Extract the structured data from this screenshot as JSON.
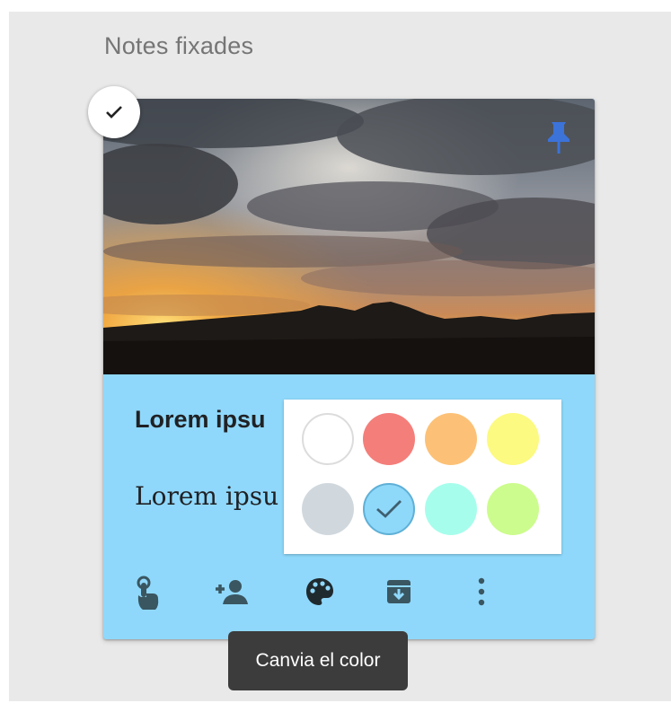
{
  "section": {
    "title": "Notes fixades"
  },
  "note": {
    "title": "Lorem ipsu",
    "body": "Lorem ipsu",
    "background_color": "#8fd8fb",
    "selected": true,
    "pinned": true
  },
  "toolbar": {
    "items": [
      {
        "name": "remind-me-icon"
      },
      {
        "name": "collaborator-icon"
      },
      {
        "name": "palette-icon"
      },
      {
        "name": "archive-icon"
      },
      {
        "name": "more-options-icon"
      }
    ]
  },
  "color_picker": {
    "swatches": [
      {
        "color": "#ffffff",
        "selected": false
      },
      {
        "color": "#f47e7a",
        "selected": false
      },
      {
        "color": "#fcc177",
        "selected": false
      },
      {
        "color": "#fcfa80",
        "selected": false
      },
      {
        "color": "#d0d8de",
        "selected": false
      },
      {
        "color": "#8ed8fa",
        "selected": true
      },
      {
        "color": "#a7fdec",
        "selected": false
      },
      {
        "color": "#ccfc8d",
        "selected": false
      }
    ]
  },
  "tooltip": {
    "text": "Canvia el color"
  }
}
